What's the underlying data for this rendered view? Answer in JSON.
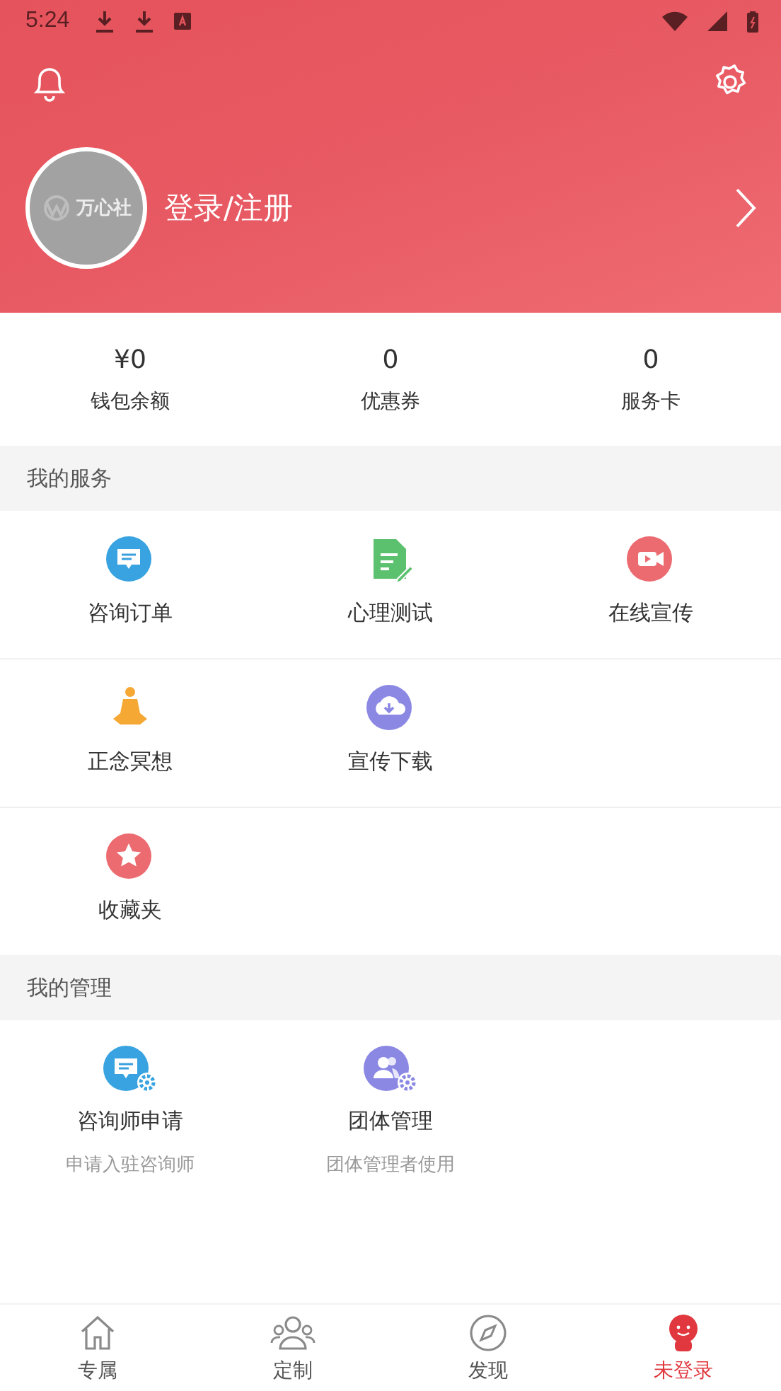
{
  "status_bar": {
    "time": "5:24"
  },
  "profile": {
    "avatar_label": "万心社",
    "login": "登录/注册"
  },
  "stats": [
    {
      "value": "¥0",
      "label": "钱包余额"
    },
    {
      "value": "0",
      "label": "优惠券"
    },
    {
      "value": "0",
      "label": "服务卡"
    }
  ],
  "services": {
    "title": "我的服务",
    "rows": [
      [
        {
          "label": "咨询订单"
        },
        {
          "label": "心理测试"
        },
        {
          "label": "在线宣传"
        }
      ],
      [
        {
          "label": "正念冥想"
        },
        {
          "label": "宣传下载"
        }
      ],
      [
        {
          "label": "收藏夹"
        }
      ]
    ]
  },
  "management": {
    "title": "我的管理",
    "items": [
      {
        "label": "咨询师申请",
        "description": "申请入驻咨询师"
      },
      {
        "label": "团体管理",
        "description": "团体管理者使用"
      }
    ]
  },
  "tab_bar": [
    {
      "label": "专属",
      "selected": false
    },
    {
      "label": "定制",
      "selected": false
    },
    {
      "label": "发现",
      "selected": false
    },
    {
      "label": "未登录",
      "selected": true
    }
  ]
}
